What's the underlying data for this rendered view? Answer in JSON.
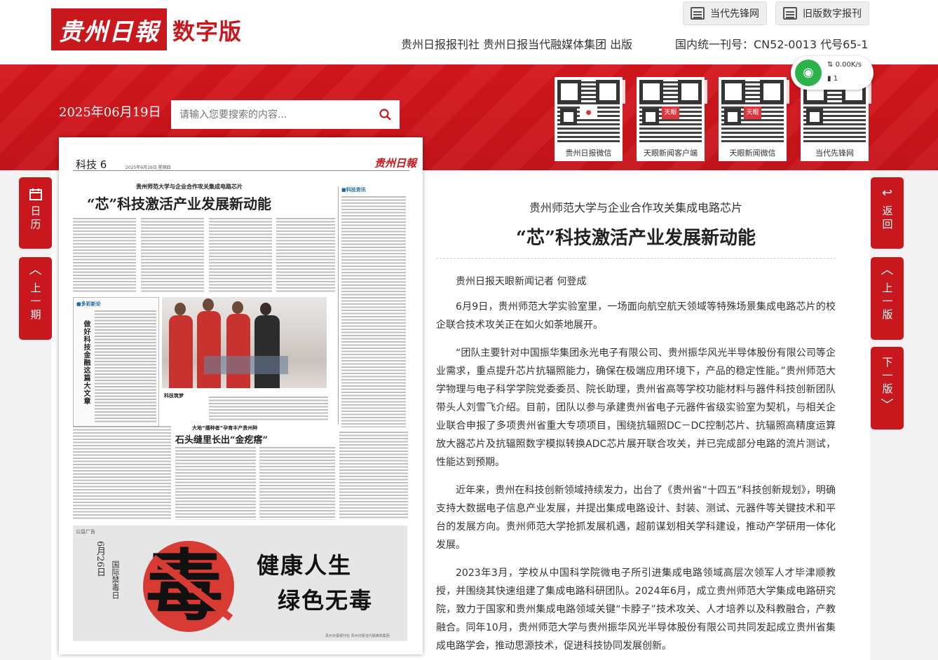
{
  "header": {
    "logo_text": "贵州日報",
    "logo_sub": "数字版",
    "links": [
      {
        "label": "当代先锋网",
        "icon": "calendar-icon"
      },
      {
        "label": "旧版数字报刊",
        "icon": "calendar-icon"
      }
    ],
    "publisher": "贵州日报报刊社 贵州日报当代融媒体集团 出版",
    "issn": "国内统一刊号：CN52-0013 代号65-1"
  },
  "network_widget": {
    "speed": "0.00K/s",
    "count": "1"
  },
  "toolbar": {
    "date": "2025年06月19日",
    "search_placeholder": "请输入您要搜索的内容..."
  },
  "qr_codes": [
    {
      "label": "贵州日报微信",
      "badge": ""
    },
    {
      "label": "天眼新闻客户端",
      "badge": "天眼"
    },
    {
      "label": "天眼新闻微信",
      "badge": "天眼"
    },
    {
      "label": "当代先锋网",
      "badge": ""
    }
  ],
  "side_buttons": {
    "calendar": "日历",
    "prev_issue": "上一期",
    "back": "返回",
    "prev_page": "上一版",
    "next_page": "下一版"
  },
  "newspaper": {
    "section": "科技 6",
    "date": "2025年6月19日 星期四",
    "masthead": "贵州日報",
    "kicker": "贵州师范大学与企业合作攻关集成电路芯片",
    "headline": "“芯”科技激活产业发展新动能",
    "side_tag": "■科技资讯",
    "box_tag": "■多彩新论",
    "box_title": "做好科技金融这篇大文章",
    "photo_caption": "科技筑梦",
    "story2_kicker": "大地“播种者”孕育丰产贵州种",
    "story2_headline": "石头缝里长出“金疙瘩”",
    "ad_tag": "公益广告",
    "ad_date": "6月26日",
    "ad_day": "国际禁毒日",
    "ad_char": "毒",
    "ad_line1": "健康人生",
    "ad_line2": "绿色无毒",
    "footer": "贵州日报报刊社 贵州日报当代融媒体集团"
  },
  "article": {
    "subhead": "贵州师范大学与企业合作攻关集成电路芯片",
    "headline": "“芯”科技激活产业发展新动能",
    "byline": "贵州日报天眼新闻记者 何登成",
    "paragraphs": [
      "6月9日，贵州师范大学实验室里，一场面向航空航天领域等特殊场景集成电路芯片的校企联合技术攻关正在如火如荼地展开。",
      "“团队主要针对中国振华集团永光电子有限公司、贵州振华风光半导体股份有限公司等企业需求，重点提升芯片抗辐照能力，确保在极端应用环境下，产品的稳定性能。”贵州师范大学物理与电子科学学院党委委员、院长助理，贵州省高等学校功能材料与器件科技创新团队带头人刘雪飞介绍。目前，团队以参与承建贵州省电子元器件省级实验室为契机，与相关企业联合申报了多项贵州省重大专项项目，围绕抗辐照DC－DC控制芯片、抗辐照高精度运算放大器芯片及抗辐照数字模拟转换ADC芯片展开联合攻关，并已完成部分电路的流片测试，性能达到预期。",
      "近年来，贵州在科技创新领域持续发力，出台了《贵州省“十四五”科技创新规划》，明确支持大数据电子信息产业发展，并提出集成电路设计、封装、测试、元器件等关键技术和平台的发展方向。贵州师范大学抢抓发展机遇，超前谋划相关学科建设，推动产学研用一体化发展。",
      "2023年3月，学校从中国科学院微电子所引进集成电路领域高层次领军人才毕津顺教授，并围绕其快速组建了集成电路科研团队。2024年6月，成立贵州师范大学集成电路研究院，致力于国家和贵州集成电路领域关键“卡脖子”技术攻关、人才培养以及科教融合，产教融合。同年10月，贵州师范大学与贵州振华风光半导体股份有限公司共同发起成立贵州省集成电路学会，推动思源技术，促进科技协同发展创新。"
    ]
  }
}
